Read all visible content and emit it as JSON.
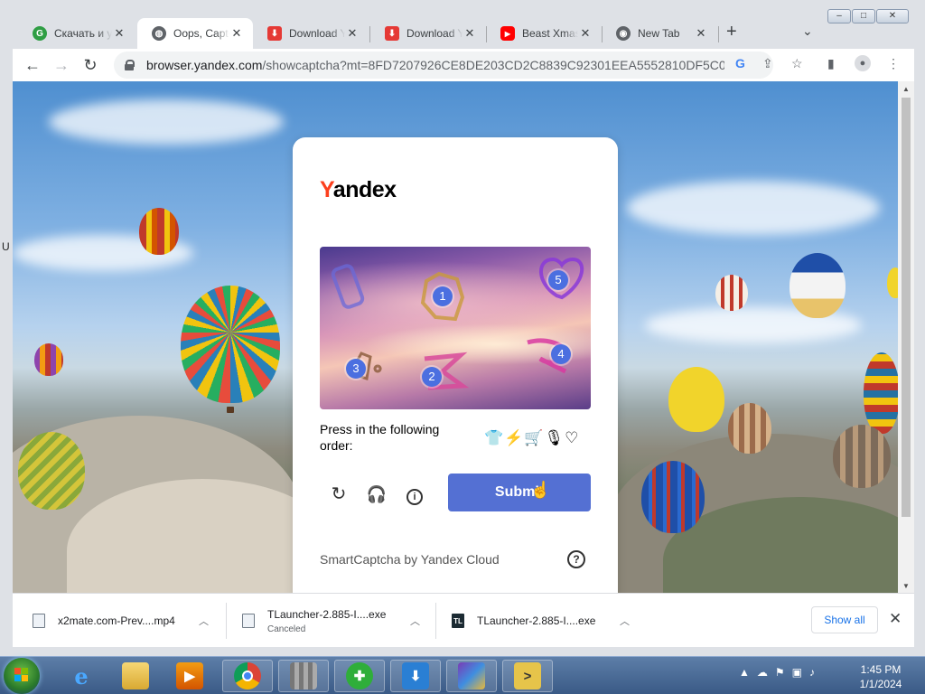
{
  "browser": {
    "tabs": [
      {
        "title": "Скачать и у",
        "favicon": "green-g-icon"
      },
      {
        "title": "Oops, Captc",
        "favicon": "globe-icon",
        "active": true
      },
      {
        "title": "Download Y",
        "favicon": "download-icon"
      },
      {
        "title": "Download Y",
        "favicon": "download-icon"
      },
      {
        "title": "Beast Xmas",
        "favicon": "youtube-icon"
      },
      {
        "title": "New Tab",
        "favicon": "chrome-icon"
      }
    ],
    "newtab_label": "+",
    "url_host": "browser.yandex.com",
    "url_path": "/showcaptcha?mt=8FD7207926CE8DE203CD2C8839C92301EEA5552810DF5C0F18..."
  },
  "captcha": {
    "logo": "Yandex",
    "badges": [
      "1",
      "2",
      "3",
      "4",
      "5"
    ],
    "prompt": "Press in the following order:",
    "order_icons": "👕⚡🛒🎙♡",
    "submit_label": "Submit",
    "footer": "SmartCaptcha by Yandex Cloud",
    "help_label": "?"
  },
  "page": {
    "edge_letter": "U"
  },
  "downloads": {
    "items": [
      {
        "name": "x2mate.com-Prev....mp4",
        "status": ""
      },
      {
        "name": "TLauncher-2.885-I....exe",
        "status": "Canceled"
      },
      {
        "name": "TLauncher-2.885-I....exe",
        "status": ""
      }
    ],
    "show_all": "Show all"
  },
  "taskbar": {
    "time": "1:45 PM",
    "date": "1/1/2024"
  },
  "colors": {
    "accent": "#5470d3",
    "yandex_red": "#fc3f1d",
    "badge": "#4b6fe0"
  }
}
